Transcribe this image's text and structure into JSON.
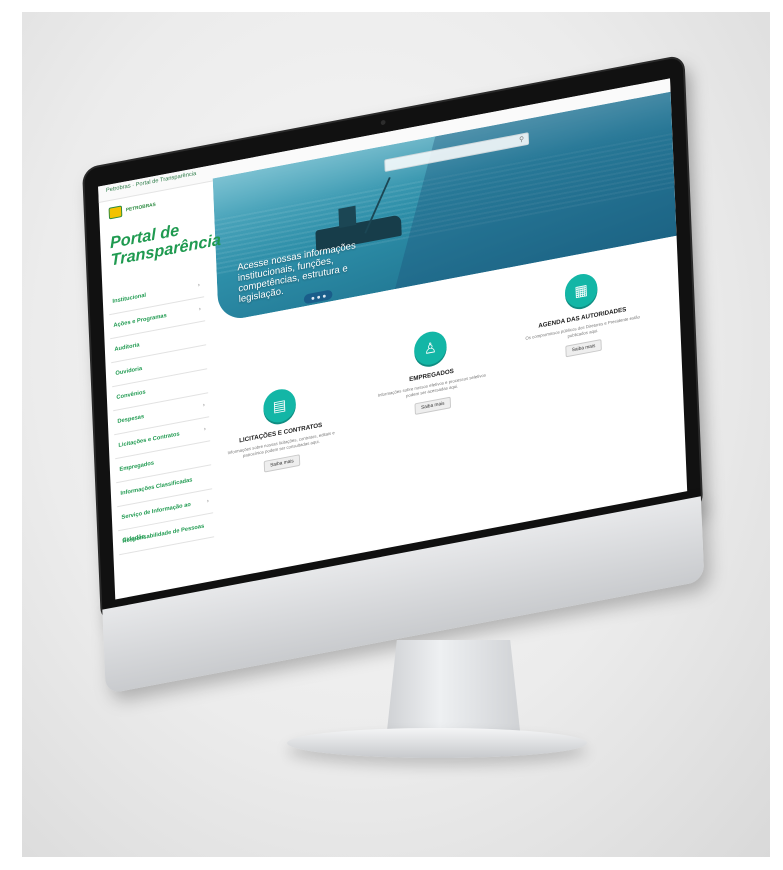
{
  "topbar": {
    "text": "Petrobras · Portal de Transparência"
  },
  "search": {
    "placeholder": ""
  },
  "logo": {
    "text": "PETROBRAS"
  },
  "portal_title": "Portal de Transparência",
  "sidebar": {
    "items": [
      {
        "label": "Institucional",
        "has_chevron": true
      },
      {
        "label": "Ações e Programas",
        "has_chevron": true
      },
      {
        "label": "Auditoria",
        "has_chevron": false
      },
      {
        "label": "Ouvidoria",
        "has_chevron": false
      },
      {
        "label": "Convênios",
        "has_chevron": false
      },
      {
        "label": "Despesas",
        "has_chevron": true
      },
      {
        "label": "Licitações e Contratos",
        "has_chevron": true
      },
      {
        "label": "Empregados",
        "has_chevron": false
      },
      {
        "label": "Informações Classificadas",
        "has_chevron": false
      },
      {
        "label": "Serviço de Informação ao Cidadão",
        "has_chevron": true
      },
      {
        "label": "Responsabilidade de Pessoas",
        "has_chevron": false
      }
    ]
  },
  "hero": {
    "caption": "Acesse nossas informações institucionais, funções, competências, estrutura e legislação.",
    "slide_count": 3
  },
  "cards": [
    {
      "title": "LICITAÇÕES E CONTRATOS",
      "desc": "Informações sobre nossas licitações, contratos, editais e patrocínios podem ser consultadas aqui.",
      "button": "Saiba mais",
      "icon": "document-icon"
    },
    {
      "title": "EMPREGADOS",
      "desc": "Informações sobre nossos efetivos e processos seletivos podem ser acessadas aqui.",
      "button": "Saiba mais",
      "icon": "people-icon"
    },
    {
      "title": "AGENDA DAS AUTORIDADES",
      "desc": "Os compromissos públicos dos Diretores e Presidente estão publicados aqui.",
      "button": "Saiba mais",
      "icon": "calendar-icon"
    }
  ],
  "colors": {
    "brand_green": "#1f9a50",
    "teal": "#13b6a6",
    "hero_blue": "#2d8ea8"
  }
}
